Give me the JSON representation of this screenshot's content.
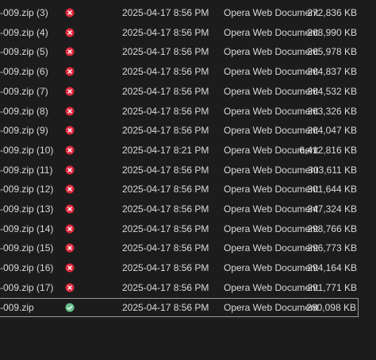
{
  "files": [
    {
      "name": "-009.zip (3)",
      "status": "error",
      "status_icon": "error-icon",
      "modified": "2025-04-17 8:56 PM",
      "type": "Opera Web Document",
      "size": "272,836 KB"
    },
    {
      "name": "-009.zip (4)",
      "status": "error",
      "status_icon": "error-icon",
      "modified": "2025-04-17 8:56 PM",
      "type": "Opera Web Document",
      "size": "268,990 KB"
    },
    {
      "name": "-009.zip (5)",
      "status": "error",
      "status_icon": "error-icon",
      "modified": "2025-04-17 8:56 PM",
      "type": "Opera Web Document",
      "size": "265,978 KB"
    },
    {
      "name": "-009.zip (6)",
      "status": "error",
      "status_icon": "error-icon",
      "modified": "2025-04-17 8:56 PM",
      "type": "Opera Web Document",
      "size": "264,837 KB"
    },
    {
      "name": "-009.zip (7)",
      "status": "error",
      "status_icon": "error-icon",
      "modified": "2025-04-17 8:56 PM",
      "type": "Opera Web Document",
      "size": "264,532 KB"
    },
    {
      "name": "-009.zip (8)",
      "status": "error",
      "status_icon": "error-icon",
      "modified": "2025-04-17 8:56 PM",
      "type": "Opera Web Document",
      "size": "263,326 KB"
    },
    {
      "name": "-009.zip (9)",
      "status": "error",
      "status_icon": "error-icon",
      "modified": "2025-04-17 8:56 PM",
      "type": "Opera Web Document",
      "size": "264,047 KB"
    },
    {
      "name": "-009.zip (10)",
      "status": "error",
      "status_icon": "error-icon",
      "modified": "2025-04-17 8:21 PM",
      "type": "Opera Web Document",
      "size": "6,412,816 KB"
    },
    {
      "name": "-009.zip (11)",
      "status": "error",
      "status_icon": "error-icon",
      "modified": "2025-04-17 8:56 PM",
      "type": "Opera Web Document",
      "size": "303,611 KB"
    },
    {
      "name": "-009.zip (12)",
      "status": "error",
      "status_icon": "error-icon",
      "modified": "2025-04-17 8:56 PM",
      "type": "Opera Web Document",
      "size": "301,644 KB"
    },
    {
      "name": "-009.zip (13)",
      "status": "error",
      "status_icon": "error-icon",
      "modified": "2025-04-17 8:56 PM",
      "type": "Opera Web Document",
      "size": "247,324 KB"
    },
    {
      "name": "-009.zip (14)",
      "status": "error",
      "status_icon": "error-icon",
      "modified": "2025-04-17 8:56 PM",
      "type": "Opera Web Document",
      "size": "298,766 KB"
    },
    {
      "name": "-009.zip (15)",
      "status": "error",
      "status_icon": "error-icon",
      "modified": "2025-04-17 8:56 PM",
      "type": "Opera Web Document",
      "size": "296,773 KB"
    },
    {
      "name": "-009.zip (16)",
      "status": "error",
      "status_icon": "error-icon",
      "modified": "2025-04-17 8:56 PM",
      "type": "Opera Web Document",
      "size": "294,164 KB"
    },
    {
      "name": "-009.zip (17)",
      "status": "error",
      "status_icon": "error-icon",
      "modified": "2025-04-17 8:56 PM",
      "type": "Opera Web Document",
      "size": "291,771 KB"
    },
    {
      "name": "-009.zip",
      "status": "ok",
      "status_icon": "check-icon",
      "modified": "2025-04-17 8:56 PM",
      "type": "Opera Web Document",
      "size": "280,098 KB",
      "selected": true
    }
  ],
  "colors": {
    "background": "#1c1c1c",
    "text": "#d9d9d9",
    "error": "#e0283c",
    "ok": "#67c08a",
    "selection_border": "#9a9a9a"
  }
}
